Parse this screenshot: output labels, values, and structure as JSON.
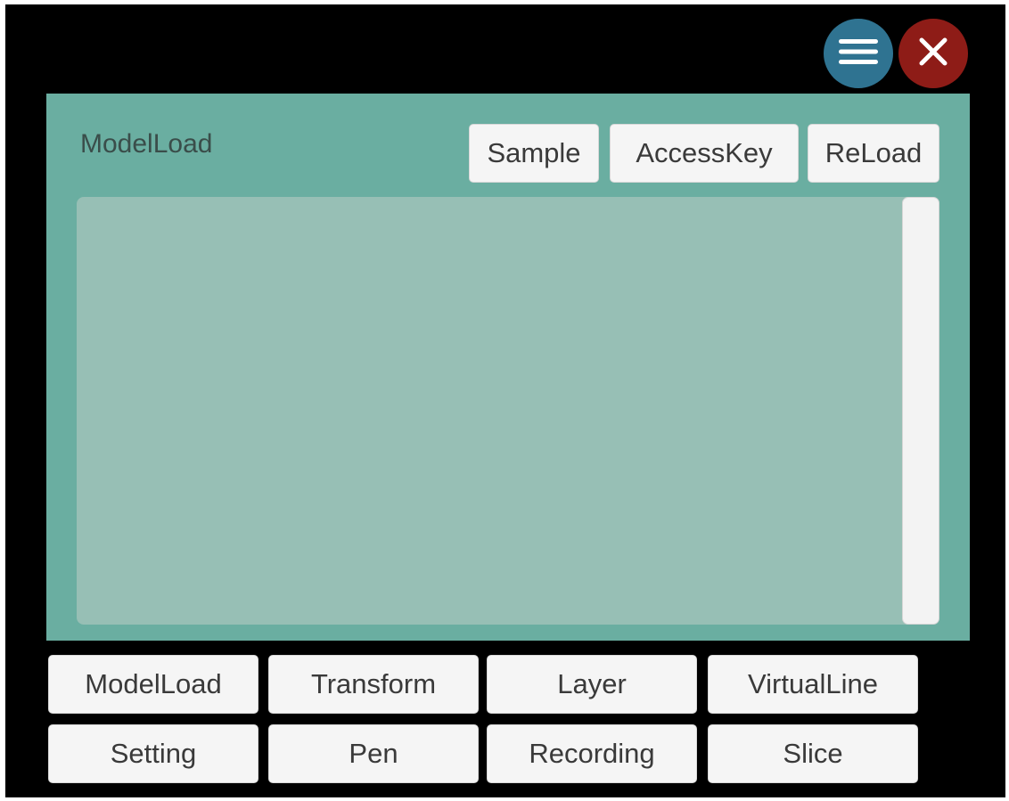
{
  "header": {
    "menu_icon": "hamburger-menu-icon",
    "close_icon": "close-icon",
    "colors": {
      "menu_button": "#2f7391",
      "close_button": "#8e1c17"
    }
  },
  "panel": {
    "title": "ModelLoad",
    "color": "#6aaea1",
    "list_color": "#97bfb5",
    "buttons": {
      "sample": "Sample",
      "accesskey": "AccessKey",
      "reload": "ReLoad"
    }
  },
  "nav": {
    "row1": [
      "ModelLoad",
      "Transform",
      "Layer",
      "VirtualLine"
    ],
    "row2": [
      "Setting",
      "Pen",
      "Recording",
      "Slice"
    ]
  }
}
